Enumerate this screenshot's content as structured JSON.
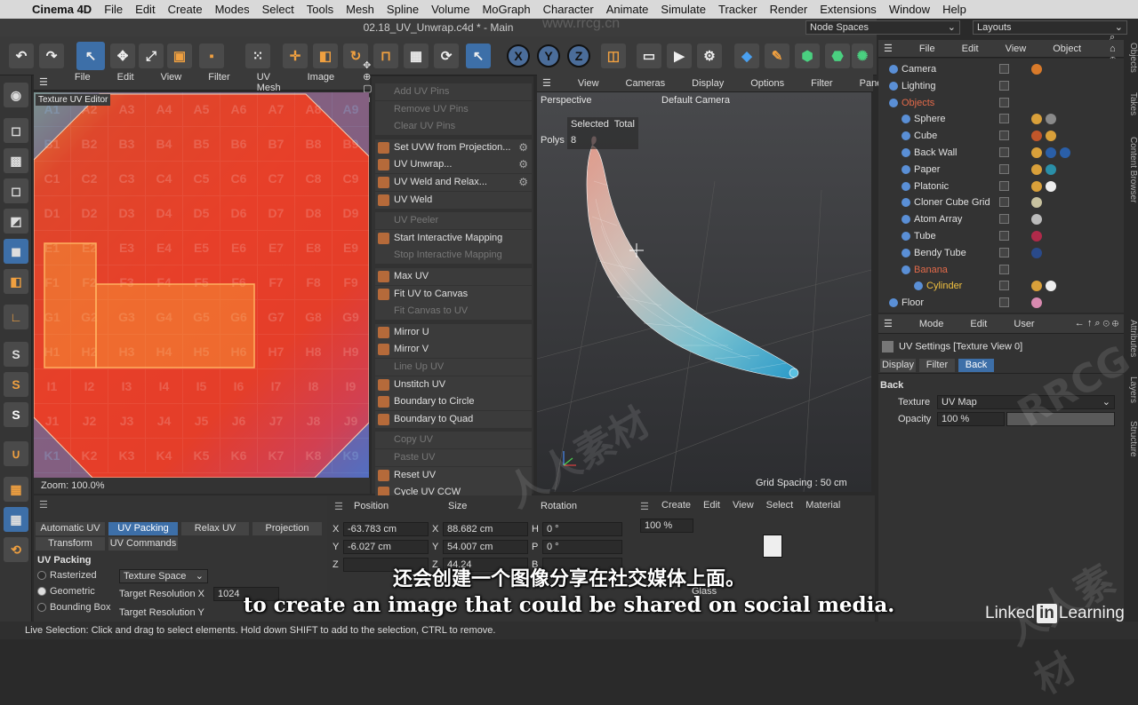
{
  "menubar": {
    "app": "Cinema 4D",
    "items": [
      "File",
      "Edit",
      "Create",
      "Modes",
      "Select",
      "Tools",
      "Mesh",
      "Spline",
      "Volume",
      "MoGraph",
      "Character",
      "Animate",
      "Simulate",
      "Tracker",
      "Render",
      "Extensions",
      "Window",
      "Help"
    ]
  },
  "window": {
    "title": "02.18_UV_Unwrap.c4d * - Main"
  },
  "topright": {
    "node_spaces": "Node Spaces",
    "layouts": "Layouts"
  },
  "toolbar": {
    "x": "X",
    "y": "Y",
    "z": "Z"
  },
  "uv_editor": {
    "menus": [
      "File",
      "Edit",
      "View",
      "Filter",
      "UV Mesh",
      "Image"
    ],
    "label": "Texture UV Editor",
    "zoom": "Zoom: 100.0%",
    "cells": [
      [
        "A1",
        "A2",
        "A3",
        "A4",
        "A5",
        "A6",
        "A7",
        "A8",
        "A9"
      ],
      [
        "B1",
        "B2",
        "B3",
        "B4",
        "B5",
        "B6",
        "B7",
        "B8",
        "B9"
      ],
      [
        "C1",
        "C2",
        "C3",
        "C4",
        "C5",
        "C6",
        "C7",
        "C8",
        "C9"
      ],
      [
        "D1",
        "D2",
        "D3",
        "D4",
        "D5",
        "D6",
        "D7",
        "D8",
        "D9"
      ],
      [
        "E1",
        "E2",
        "E3",
        "E4",
        "E5",
        "E6",
        "E7",
        "E8",
        "E9"
      ],
      [
        "F1",
        "F2",
        "F3",
        "F4",
        "F5",
        "F6",
        "F7",
        "F8",
        "F9"
      ],
      [
        "G1",
        "G2",
        "G3",
        "G4",
        "G5",
        "G6",
        "G7",
        "G8",
        "G9"
      ],
      [
        "H1",
        "H2",
        "H3",
        "H4",
        "H5",
        "H6",
        "H7",
        "H8",
        "H9"
      ],
      [
        "I1",
        "I2",
        "I3",
        "I4",
        "I5",
        "I6",
        "I7",
        "I8",
        "I9"
      ],
      [
        "J1",
        "J2",
        "J3",
        "J4",
        "J5",
        "J6",
        "J7",
        "J8",
        "J9"
      ],
      [
        "K1",
        "K2",
        "K3",
        "K4",
        "K5",
        "K6",
        "K7",
        "K8",
        "K9"
      ]
    ]
  },
  "uv_commands": [
    {
      "label": "Add UV Pins",
      "enabled": false
    },
    {
      "label": "Remove UV Pins",
      "enabled": false
    },
    {
      "label": "Clear UV Pins",
      "enabled": false
    },
    {
      "label": "Set UVW from Projection...",
      "enabled": true,
      "gear": true
    },
    {
      "label": "UV Unwrap...",
      "enabled": true,
      "gear": true
    },
    {
      "label": "UV Weld and Relax...",
      "enabled": true,
      "gear": true
    },
    {
      "label": "UV Weld",
      "enabled": true
    },
    {
      "label": "UV Peeler",
      "enabled": false
    },
    {
      "label": "Start Interactive Mapping",
      "enabled": true
    },
    {
      "label": "Stop Interactive Mapping",
      "enabled": false
    },
    {
      "label": "Max UV",
      "enabled": true
    },
    {
      "label": "Fit UV to Canvas",
      "enabled": true
    },
    {
      "label": "Fit Canvas to UV",
      "enabled": false
    },
    {
      "label": "Mirror U",
      "enabled": true
    },
    {
      "label": "Mirror V",
      "enabled": true
    },
    {
      "label": "Line Up UV",
      "enabled": false
    },
    {
      "label": "Unstitch UV",
      "enabled": true
    },
    {
      "label": "Boundary to Circle",
      "enabled": true
    },
    {
      "label": "Boundary to Quad",
      "enabled": true
    },
    {
      "label": "Copy UV",
      "enabled": false
    },
    {
      "label": "Paste UV",
      "enabled": false
    },
    {
      "label": "Reset UV",
      "enabled": true
    },
    {
      "label": "Cycle UV CCW",
      "enabled": true
    }
  ],
  "viewport": {
    "menus": [
      "View",
      "Cameras",
      "Display",
      "Options",
      "Filter",
      "Pane"
    ],
    "name": "Perspective",
    "camera": "Default Camera",
    "stats_header": "Selected  Total",
    "polys_label": "Polys",
    "polys_value": "8",
    "grid": "Grid Spacing : 50 cm"
  },
  "object_manager": {
    "menus": [
      "File",
      "Edit",
      "View",
      "Object"
    ],
    "objects": [
      {
        "name": "Camera",
        "indent": 0,
        "color": "#e0e0e0",
        "mat": [
          "#d97a2a"
        ]
      },
      {
        "name": "Lighting",
        "indent": 0,
        "color": "#e0e0e0",
        "mat": []
      },
      {
        "name": "Objects",
        "indent": 0,
        "color": "#e36a4a",
        "mat": []
      },
      {
        "name": "Sphere",
        "indent": 1,
        "color": "#e0e0e0",
        "mat": [
          "#d9a03a",
          "#8a8a8a"
        ]
      },
      {
        "name": "Cube",
        "indent": 1,
        "color": "#e0e0e0",
        "mat": [
          "#c2562a",
          "#d9a03a"
        ]
      },
      {
        "name": "Back Wall",
        "indent": 1,
        "color": "#e0e0e0",
        "mat": [
          "#d9a03a",
          "#2a5fa8",
          "#2a5fa8"
        ]
      },
      {
        "name": "Paper",
        "indent": 1,
        "color": "#e0e0e0",
        "mat": [
          "#d9a03a",
          "#2a8fa8"
        ]
      },
      {
        "name": "Platonic",
        "indent": 1,
        "color": "#e0e0e0",
        "mat": [
          "#d9a03a",
          "#eeeeee"
        ]
      },
      {
        "name": "Cloner Cube Grid",
        "indent": 1,
        "color": "#e0e0e0",
        "mat": [
          "#c8c2a0"
        ]
      },
      {
        "name": "Atom Array",
        "indent": 1,
        "color": "#e0e0e0",
        "mat": [
          "#bbbbbb"
        ]
      },
      {
        "name": "Tube",
        "indent": 1,
        "color": "#e0e0e0",
        "mat": [
          "#b02a4a"
        ]
      },
      {
        "name": "Bendy Tube",
        "indent": 1,
        "color": "#e0e0e0",
        "mat": [
          "#2a4a8a"
        ]
      },
      {
        "name": "Banana",
        "indent": 1,
        "color": "#e36a4a",
        "mat": []
      },
      {
        "name": "Cylinder",
        "indent": 2,
        "color": "#f0c040",
        "mat": [
          "#d9a03a",
          "#eeeeee"
        ]
      },
      {
        "name": "Floor",
        "indent": 0,
        "color": "#e0e0e0",
        "mat": [
          "#d88ab0"
        ]
      }
    ]
  },
  "attributes": {
    "menus": [
      "Mode",
      "Edit",
      "User"
    ],
    "title": "UV Settings [Texture View 0]",
    "tabs": [
      "Display",
      "Filter",
      "Back"
    ],
    "active_tab": "Back",
    "section": "Back",
    "texture_label": "Texture",
    "texture_value": "UV Map",
    "opacity_label": "Opacity",
    "opacity_value": "100 %",
    "opacity_fraction": 1.0
  },
  "side_tabs": [
    "Objects",
    "Takes",
    "Content Browser",
    "Attributes",
    "Layers",
    "Structure"
  ],
  "uv_tools": {
    "tabs": [
      "Automatic UV",
      "UV Packing",
      "Relax UV",
      "Projection",
      "Transform",
      "UV Commands"
    ],
    "active_tab": "UV Packing",
    "section": "UV Packing",
    "options": [
      "Rasterized",
      "Geometric",
      "Bounding Box"
    ],
    "selected_option": "Geometric",
    "preset_value": "Texture Space",
    "res_x_label": "Target Resolution X",
    "res_x_value": "1024",
    "res_y_label": "Target Resolution Y"
  },
  "coords": {
    "headers": [
      "Position",
      "Size",
      "Rotation"
    ],
    "rows": [
      {
        "axis": "X",
        "pos": "-63.783 cm",
        "size_axis": "X",
        "size": "88.682 cm",
        "rot_axis": "H",
        "rot": "0 °"
      },
      {
        "axis": "Y",
        "pos": "-6.027 cm",
        "size_axis": "Y",
        "size": "54.007 cm",
        "rot_axis": "P",
        "rot": "0 °"
      },
      {
        "axis": "Z",
        "pos": "",
        "size_axis": "Z",
        "size": "44.24",
        "rot_axis": "B",
        "rot": ""
      }
    ]
  },
  "material_manager": {
    "menus": [
      "Create",
      "Edit",
      "View",
      "Select",
      "Material"
    ],
    "zoom": "100 %",
    "item_label": "Glass"
  },
  "status": "Live Selection: Click and drag to select elements. Hold down SHIFT to add to the selection, CTRL to remove.",
  "subtitles": {
    "zh": "还会创建一个图像分享在社交媒体上面。",
    "en": "to create an image that could be shared on social media."
  },
  "watermark": {
    "text1": "RRCG",
    "text2": "人人素材",
    "url": "www.rrcg.cn"
  },
  "branding": {
    "linkedin_pre": "Linked",
    "linkedin_box": "in",
    "linkedin_post": "Learning"
  },
  "colors": {
    "accent": "#3d6fa8",
    "menubar_bg": "#d9d9d9",
    "panel_bg": "#333333"
  }
}
